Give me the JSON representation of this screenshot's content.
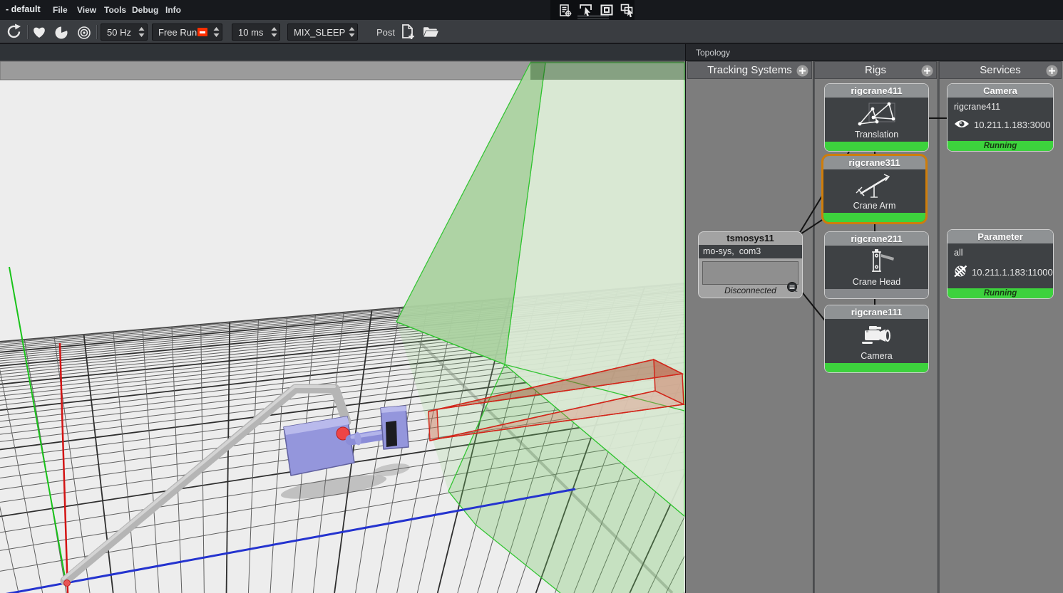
{
  "app": {
    "title": "- default",
    "menus": [
      "File",
      "View",
      "Tools",
      "Debug",
      "Info"
    ]
  },
  "mini_toolbar": {
    "icons": [
      "script-settings-icon",
      "select-region-icon",
      "frame-select-icon",
      "select-windows-icon"
    ]
  },
  "toolbar": {
    "frequency_value": "50 Hz",
    "run_mode_value": "Free Run",
    "interval_value": "10 ms",
    "mix_mode_value": "MIX_SLEEP",
    "post_label": "Post",
    "run_badge_color": "#ff2f00"
  },
  "topology": {
    "title": "Topology",
    "columns": [
      {
        "label": "Tracking Systems"
      },
      {
        "label": "Rigs"
      },
      {
        "label": "Services"
      }
    ],
    "tracking_system": {
      "title": "tsmosys11",
      "driver": "mo-sys,  com3",
      "status": "Disconnected"
    },
    "rigs": [
      {
        "title": "rigcrane411",
        "label": "Translation",
        "status": "running",
        "selected": false
      },
      {
        "title": "rigcrane311",
        "label": "Crane Arm",
        "status": "running",
        "selected": true
      },
      {
        "title": "rigcrane211",
        "label": "Crane Head",
        "status": "idle",
        "selected": false
      },
      {
        "title": "rigcrane111",
        "label": "Camera",
        "status": "running",
        "selected": false
      }
    ],
    "services": [
      {
        "title": "Camera",
        "target": "rigcrane411",
        "address": "10.211.1.183:3000",
        "status": "Running"
      },
      {
        "title": "Parameter",
        "target": "all",
        "address": "10.211.1.183:11000",
        "status": "Running"
      }
    ],
    "colors": {
      "running": "#3dd23d",
      "selection": "#cf7d0a",
      "idle_bar": "#87898c"
    }
  },
  "scene": {
    "axes": {
      "x_color": "#d31414",
      "y_color": "#19c319",
      "z_color": "#2433cf"
    },
    "frustums": {
      "tracking_green": "#2dc32d",
      "camera_red": "#d2261a"
    }
  }
}
